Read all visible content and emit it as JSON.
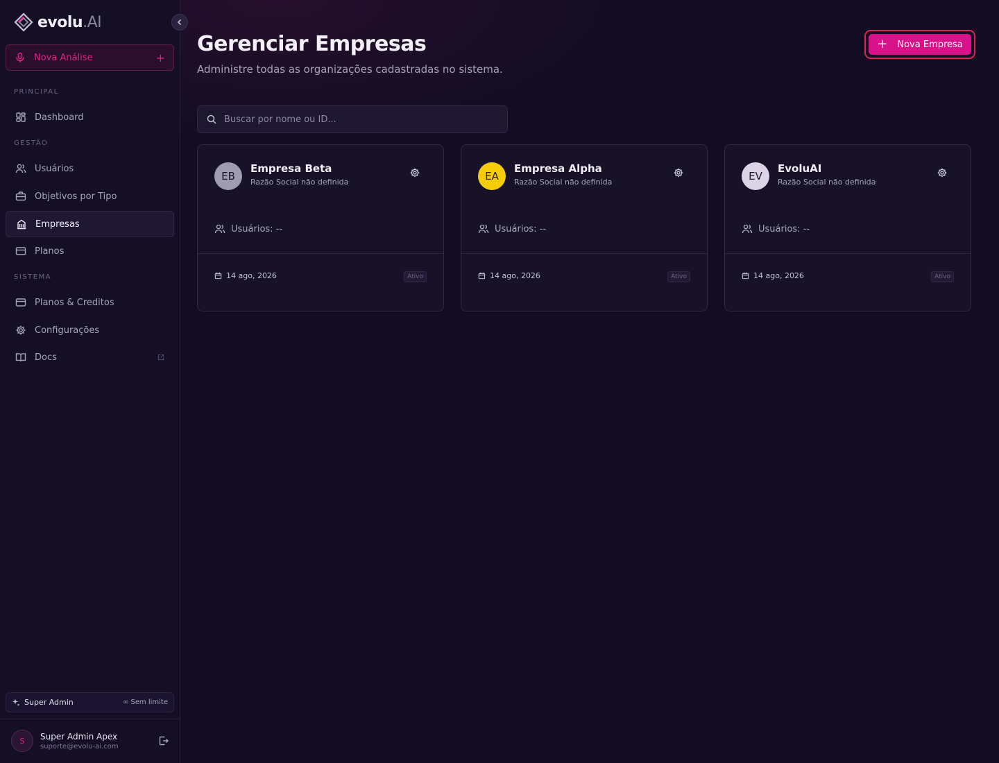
{
  "brand": {
    "name": "evolu",
    "suffix": ".AI"
  },
  "sidebar": {
    "new_analysis_label": "Nova Análise",
    "sections": {
      "principal": "PRINCIPAL",
      "gestao": "GESTÃO",
      "sistema": "SISTEMA"
    },
    "items": [
      {
        "label": "Dashboard",
        "icon": "dashboard-icon"
      },
      {
        "label": "Usuários",
        "icon": "users-icon"
      },
      {
        "label": "Objetivos por Tipo",
        "icon": "briefcase-icon"
      },
      {
        "label": "Empresas",
        "icon": "building-icon",
        "active": true
      },
      {
        "label": "Planos",
        "icon": "card-icon"
      },
      {
        "label": "Planos & Creditos",
        "icon": "card-icon"
      },
      {
        "label": "Configurações",
        "icon": "gear-icon"
      },
      {
        "label": "Docs",
        "icon": "book-icon"
      }
    ],
    "role": {
      "label": "Super Admin",
      "limit": "Sem limite"
    },
    "user": {
      "initial": "S",
      "name": "Super Admin Apex",
      "email": "suporte@evolu-ai.com"
    }
  },
  "main": {
    "title": "Gerenciar Empresas",
    "subtitle": "Administre todas as organizações cadastradas no sistema.",
    "new_button_label": "Nova Empresa",
    "search_placeholder": "Buscar por nome ou ID...",
    "companies": [
      {
        "initials": "EB",
        "name": "Empresa Beta",
        "legal": "Razão Social não definida",
        "users": "Usuários: --",
        "date": "14 ago, 2026",
        "status": "Ativo",
        "avatar_bg": "#a09cb0",
        "avatar_fg": "#1a1428"
      },
      {
        "initials": "EA",
        "name": "Empresa Alpha",
        "legal": "Razão Social não definida",
        "users": "Usuários: --",
        "date": "14 ago, 2026",
        "status": "Ativo",
        "avatar_bg": "#f5cc0a",
        "avatar_fg": "#2a1f00"
      },
      {
        "initials": "EV",
        "name": "EvoluAI",
        "legal": "Razão Social não definida",
        "users": "Usuários: --",
        "date": "14 ago, 2026",
        "status": "Ativo",
        "avatar_bg": "#ddd3e6",
        "avatar_fg": "#1a1428"
      }
    ]
  }
}
